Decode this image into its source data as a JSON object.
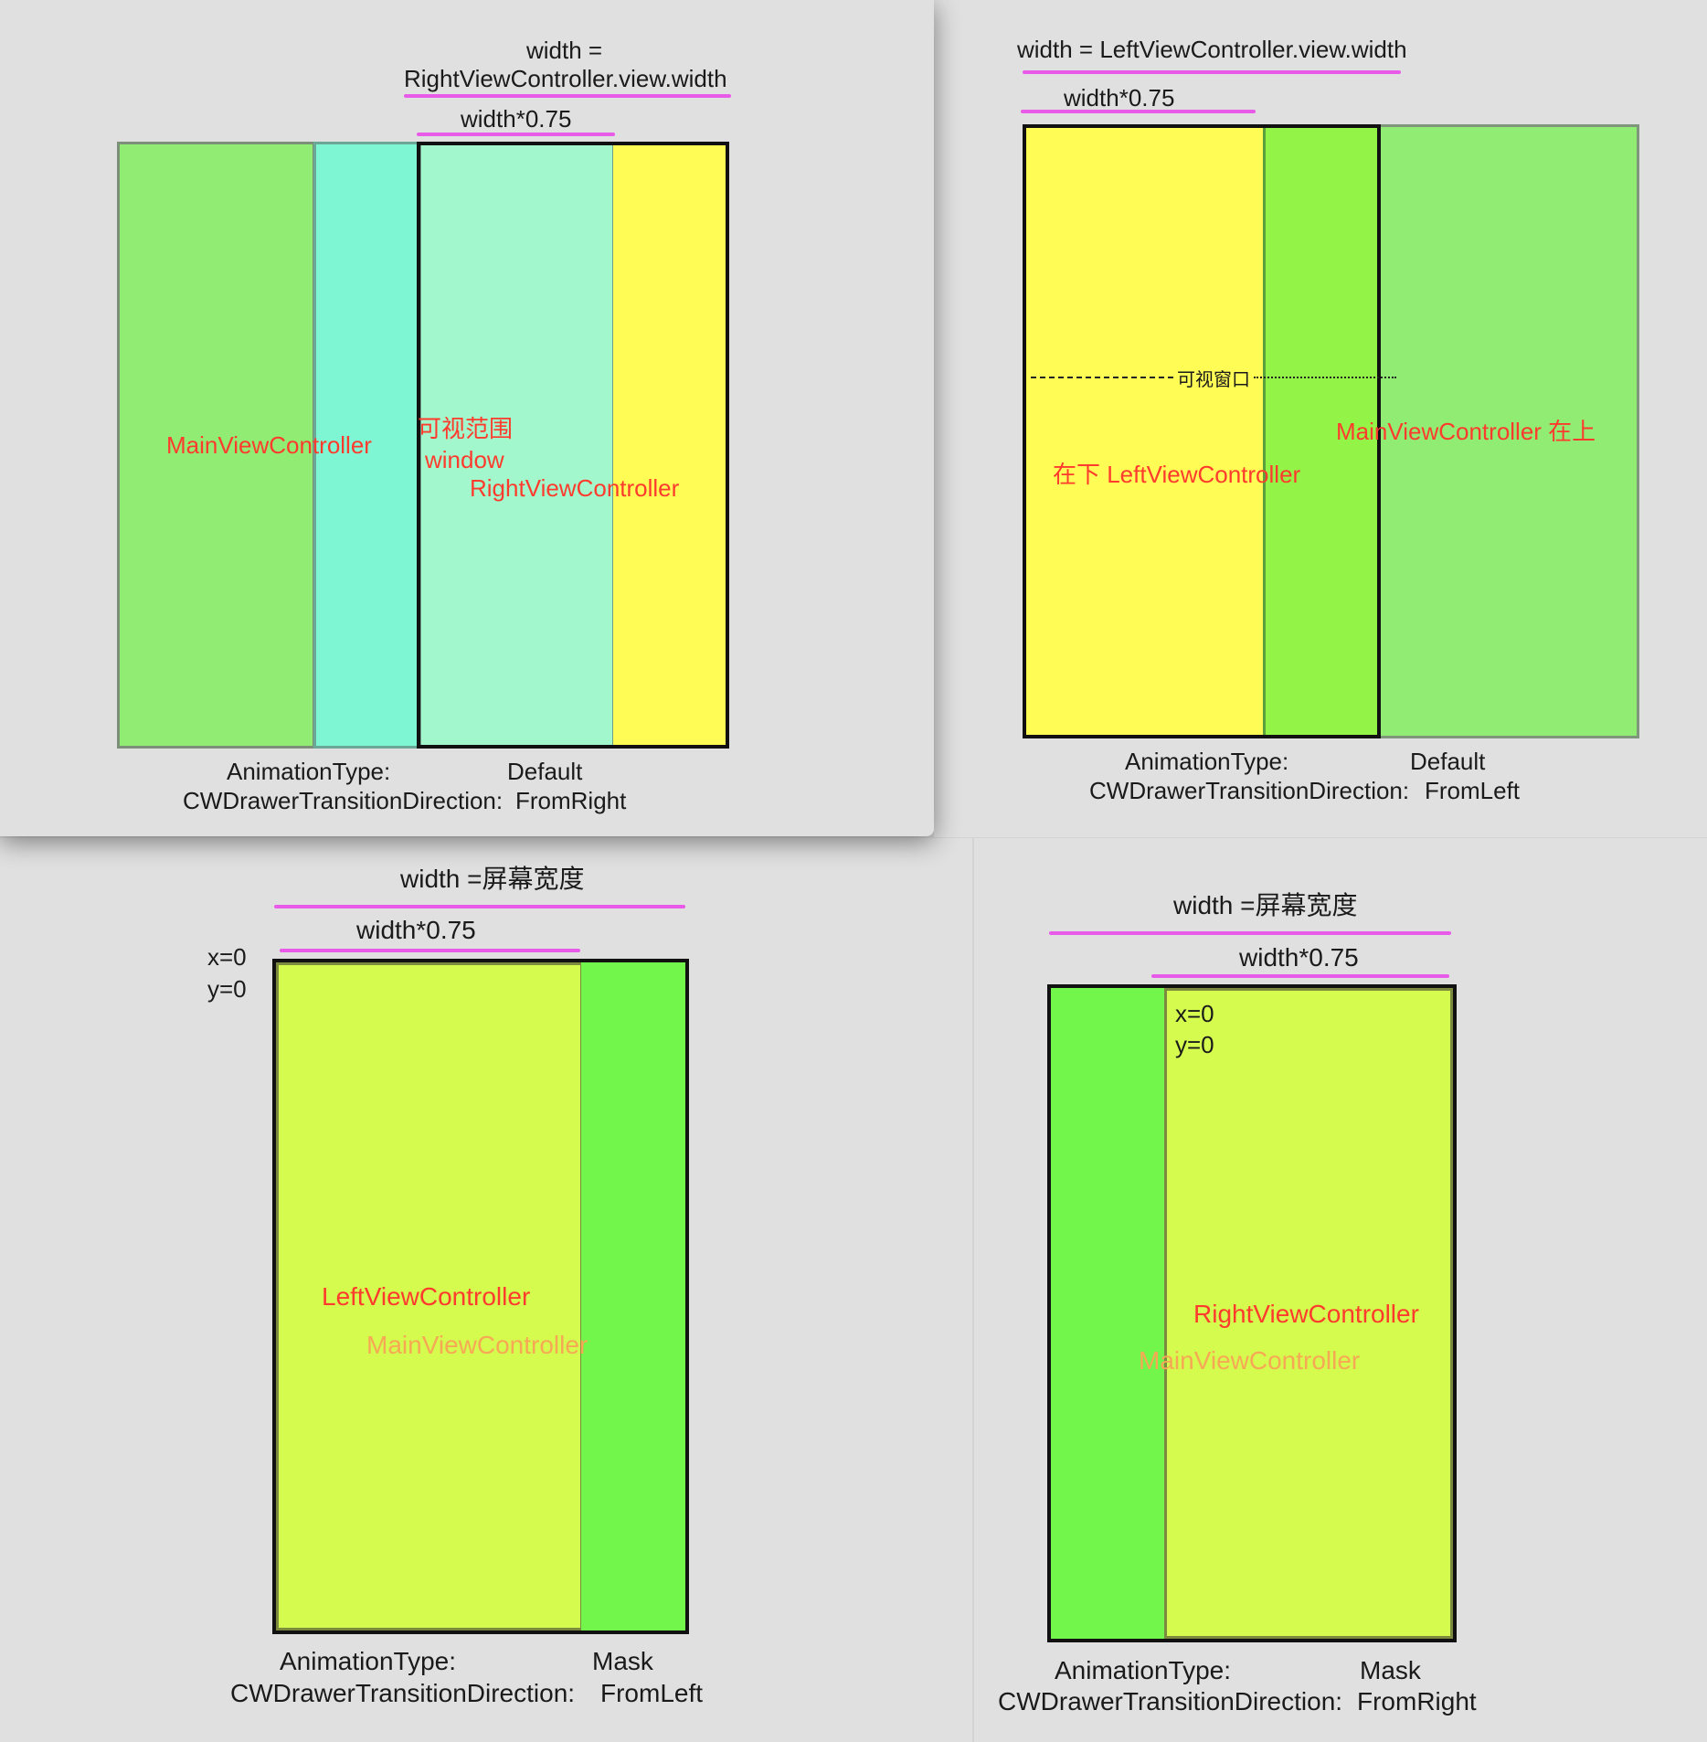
{
  "panels": [
    {
      "width_label": [
        "width =",
        "RightViewController.view.width"
      ],
      "ratio_label": "width*0.75",
      "labels": {
        "main": "MainViewController",
        "visible_range": "可视范围",
        "window": "window",
        "right": "RightViewController"
      },
      "animation_type_label": "AnimationType:",
      "animation_type_value": "Default",
      "direction_label": "CWDrawerTransitionDirection:",
      "direction_value": "FromRight"
    },
    {
      "width_label": "width = LeftViewController.view.width",
      "ratio_label": "width*0.75",
      "visible_window_label": "可视窗口",
      "labels": {
        "main": "MainViewController  在上",
        "left": "在下  LeftViewController"
      },
      "animation_type_label": "AnimationType:",
      "animation_type_value": "Default",
      "direction_label": "CWDrawerTransitionDirection:",
      "direction_value": "FromLeft"
    },
    {
      "width_label": "width =屏幕宽度",
      "ratio_label": "width*0.75",
      "origin_x": "x=0",
      "origin_y": "y=0",
      "labels": {
        "left": "LeftViewController",
        "main": "MainViewController"
      },
      "animation_type_label": "AnimationType:",
      "animation_type_value": "Mask",
      "direction_label": "CWDrawerTransitionDirection:",
      "direction_value": "FromLeft"
    },
    {
      "width_label": "width =屏幕宽度",
      "ratio_label": "width*0.75",
      "origin_x": "x=0",
      "origin_y": "y=0",
      "labels": {
        "right": "RightViewController",
        "main": "MainViewController"
      },
      "animation_type_label": "AnimationType:",
      "animation_type_value": "Mask",
      "direction_label": "CWDrawerTransitionDirection:",
      "direction_value": "FromRight"
    }
  ],
  "colors": {
    "green": "#90ec72",
    "cyan": "#7ff6d3",
    "mint": "#a2f8cc",
    "yellow": "#fffc55",
    "bright_green": "#93f447",
    "lime": "#d4fb4d",
    "mask_green": "#72f64b",
    "underline": "#e85ae8",
    "label_red": "#ff3b2e"
  }
}
